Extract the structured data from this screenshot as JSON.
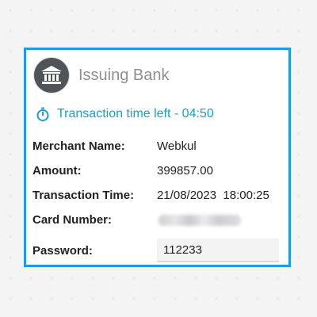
{
  "colors": {
    "card_border": "#1e9be6",
    "timer_text": "#17a0c8",
    "logo_bg": "#4f5458"
  },
  "header": {
    "icon": "bank-icon",
    "title": "Issuing Bank"
  },
  "timer": {
    "icon": "stopwatch-icon",
    "text": "Transaction time left - 04:50"
  },
  "details": {
    "merchant_label": "Merchant Name:",
    "merchant_value": "Webkul",
    "amount_label": "Amount:",
    "amount_value": "399857.00",
    "time_label": "Transaction Time:",
    "time_value": "21/08/2023  18:00:25",
    "card_label": "Card Number:"
  },
  "password": {
    "label": "Password:",
    "value": "112233"
  }
}
